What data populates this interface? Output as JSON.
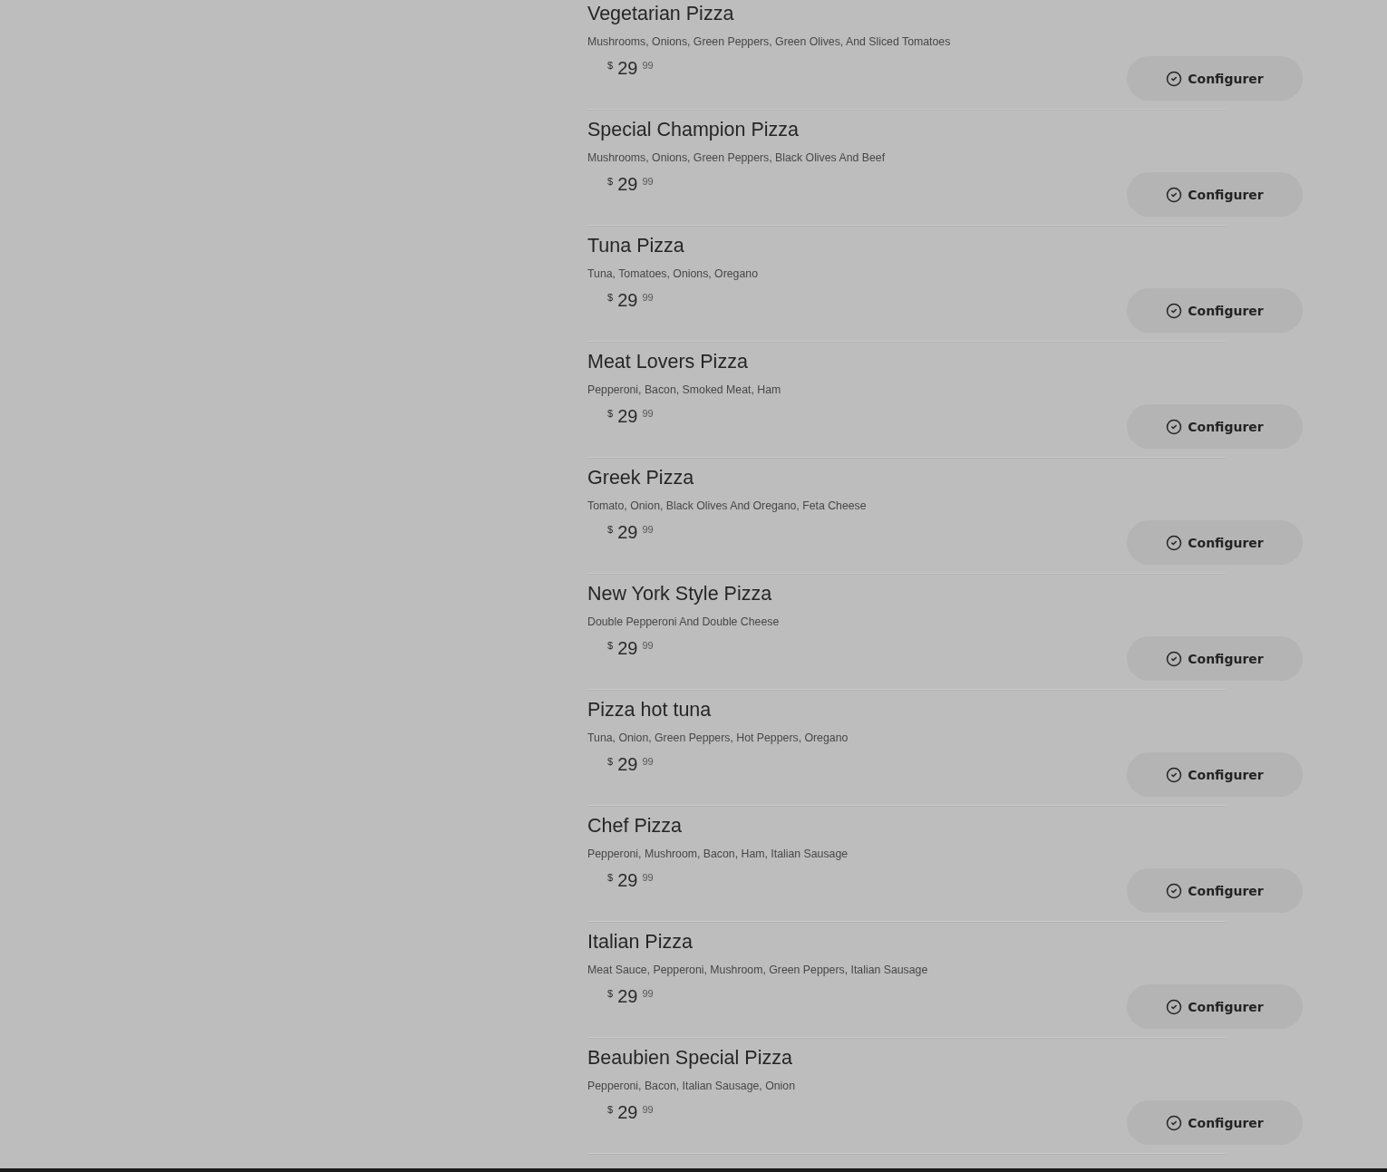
{
  "menu_items": [
    {
      "name": "Vegetarian Pizza",
      "description": "Mushrooms, Onions, Green Peppers, Green Olives, And Sliced Tomatoes",
      "price": {
        "currency": "$",
        "whole": "29",
        "cents": "99"
      },
      "button": "Configurer"
    },
    {
      "name": "Special Champion Pizza",
      "description": "Mushrooms, Onions, Green Peppers, Black Olives And Beef",
      "price": {
        "currency": "$",
        "whole": "29",
        "cents": "99"
      },
      "button": "Configurer"
    },
    {
      "name": "Tuna Pizza",
      "description": "Tuna, Tomatoes, Onions, Oregano",
      "price": {
        "currency": "$",
        "whole": "29",
        "cents": "99"
      },
      "button": "Configurer"
    },
    {
      "name": "Meat Lovers Pizza",
      "description": "Pepperoni, Bacon, Smoked Meat, Ham",
      "price": {
        "currency": "$",
        "whole": "29",
        "cents": "99"
      },
      "button": "Configurer"
    },
    {
      "name": "Greek Pizza",
      "description": "Tomato, Onion, Black Olives And Oregano, Feta Cheese",
      "price": {
        "currency": "$",
        "whole": "29",
        "cents": "99"
      },
      "button": "Configurer"
    },
    {
      "name": "New York Style Pizza",
      "description": "Double Pepperoni And Double Cheese",
      "price": {
        "currency": "$",
        "whole": "29",
        "cents": "99"
      },
      "button": "Configurer"
    },
    {
      "name": "Pizza hot tuna",
      "description": "Tuna, Onion, Green Peppers, Hot Peppers, Oregano",
      "price": {
        "currency": "$",
        "whole": "29",
        "cents": "99"
      },
      "button": "Configurer"
    },
    {
      "name": "Chef Pizza",
      "description": "Pepperoni, Mushroom, Bacon, Ham, Italian Sausage",
      "price": {
        "currency": "$",
        "whole": "29",
        "cents": "99"
      },
      "button": "Configurer"
    },
    {
      "name": "Italian Pizza",
      "description": "Meat Sauce, Pepperoni, Mushroom, Green Peppers, Italian Sausage",
      "price": {
        "currency": "$",
        "whole": "29",
        "cents": "99"
      },
      "button": "Configurer"
    },
    {
      "name": "Beaubien Special Pizza",
      "description": "Pepperoni, Bacon, Italian Sausage, Onion",
      "price": {
        "currency": "$",
        "whole": "29",
        "cents": "99"
      },
      "button": "Configurer"
    }
  ]
}
